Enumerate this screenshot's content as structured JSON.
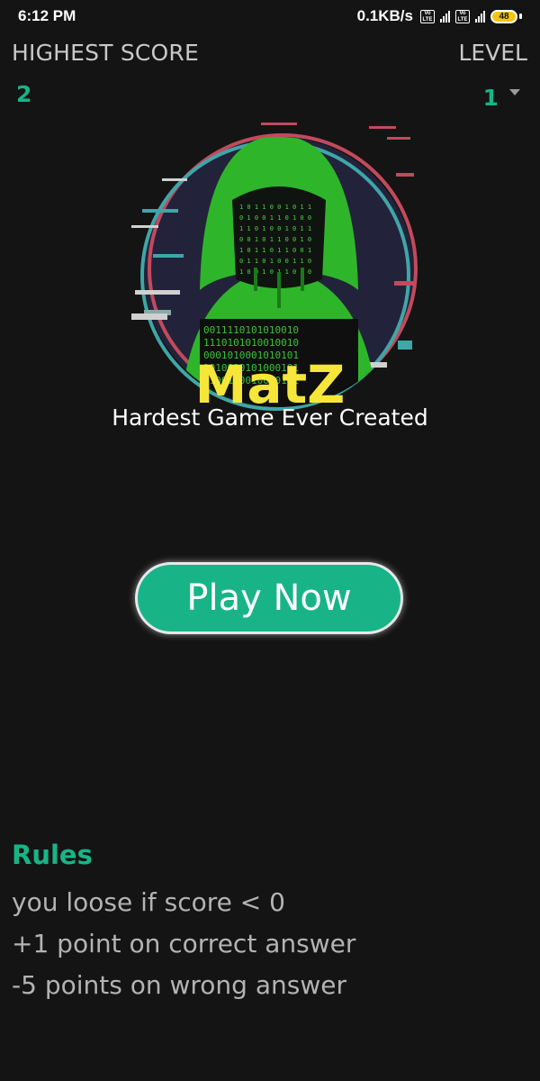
{
  "status_bar": {
    "time": "6:12 PM",
    "net_speed": "0.1KB/s",
    "battery": "48",
    "icons": [
      "volte-icon",
      "signal-icon",
      "volte-icon",
      "4g-signal-icon",
      "battery-icon"
    ]
  },
  "header": {
    "highest_score_label": "HIGHEST SCORE",
    "highest_score_value": "2",
    "level_label": "LEVEL",
    "level_value": "1"
  },
  "logo": {
    "icon": "hooded-hacker-icon",
    "title": "MatZ",
    "subtitle": "Hardest Game Ever Created"
  },
  "play_button": {
    "label": "Play Now"
  },
  "rules": {
    "title": "Rules",
    "items": [
      "you loose if score < 0",
      "+1 point on correct answer",
      "-5 points on wrong answer"
    ]
  },
  "colors": {
    "background": "#141414",
    "accent": "#18b487",
    "title": "#f6e63a",
    "hood_green": "#2fb52a",
    "muted_text": "#b3b3b3"
  }
}
